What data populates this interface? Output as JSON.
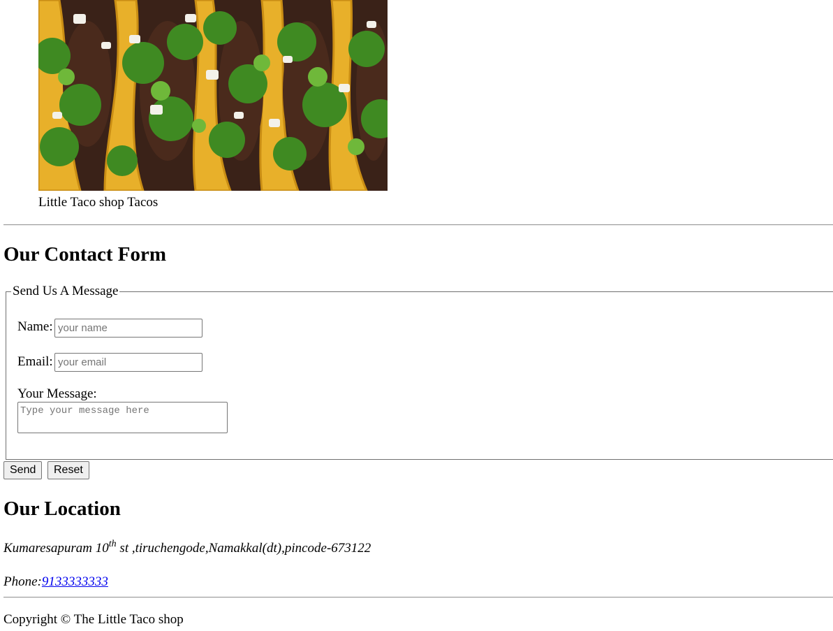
{
  "figure": {
    "caption": "Little Taco shop Tacos"
  },
  "contact": {
    "heading": "Our Contact Form",
    "legend": "Send Us A Message",
    "name_label": "Name:",
    "name_placeholder": "your name",
    "email_label": "Email:",
    "email_placeholder": "your email",
    "message_label": "Your Message:",
    "message_placeholder": "Type your message here",
    "send_label": "Send",
    "reset_label": "Reset"
  },
  "location": {
    "heading": "Our Location",
    "address_pre": "Kumaresapuram 10",
    "address_sup": "th",
    "address_post": " st ,tiruchengode,Namakkal(dt),pincode-673122",
    "phone_label": "Phone:",
    "phone_number": "9133333333"
  },
  "footer": {
    "copyright": "Copyright © The Little Taco shop"
  },
  "colors": {
    "link": "#0000ee",
    "rule": "#9a9a9a",
    "tortilla": "#e8b02a",
    "cilantro": "#3f8a22",
    "meat": "#4a2a1c"
  }
}
